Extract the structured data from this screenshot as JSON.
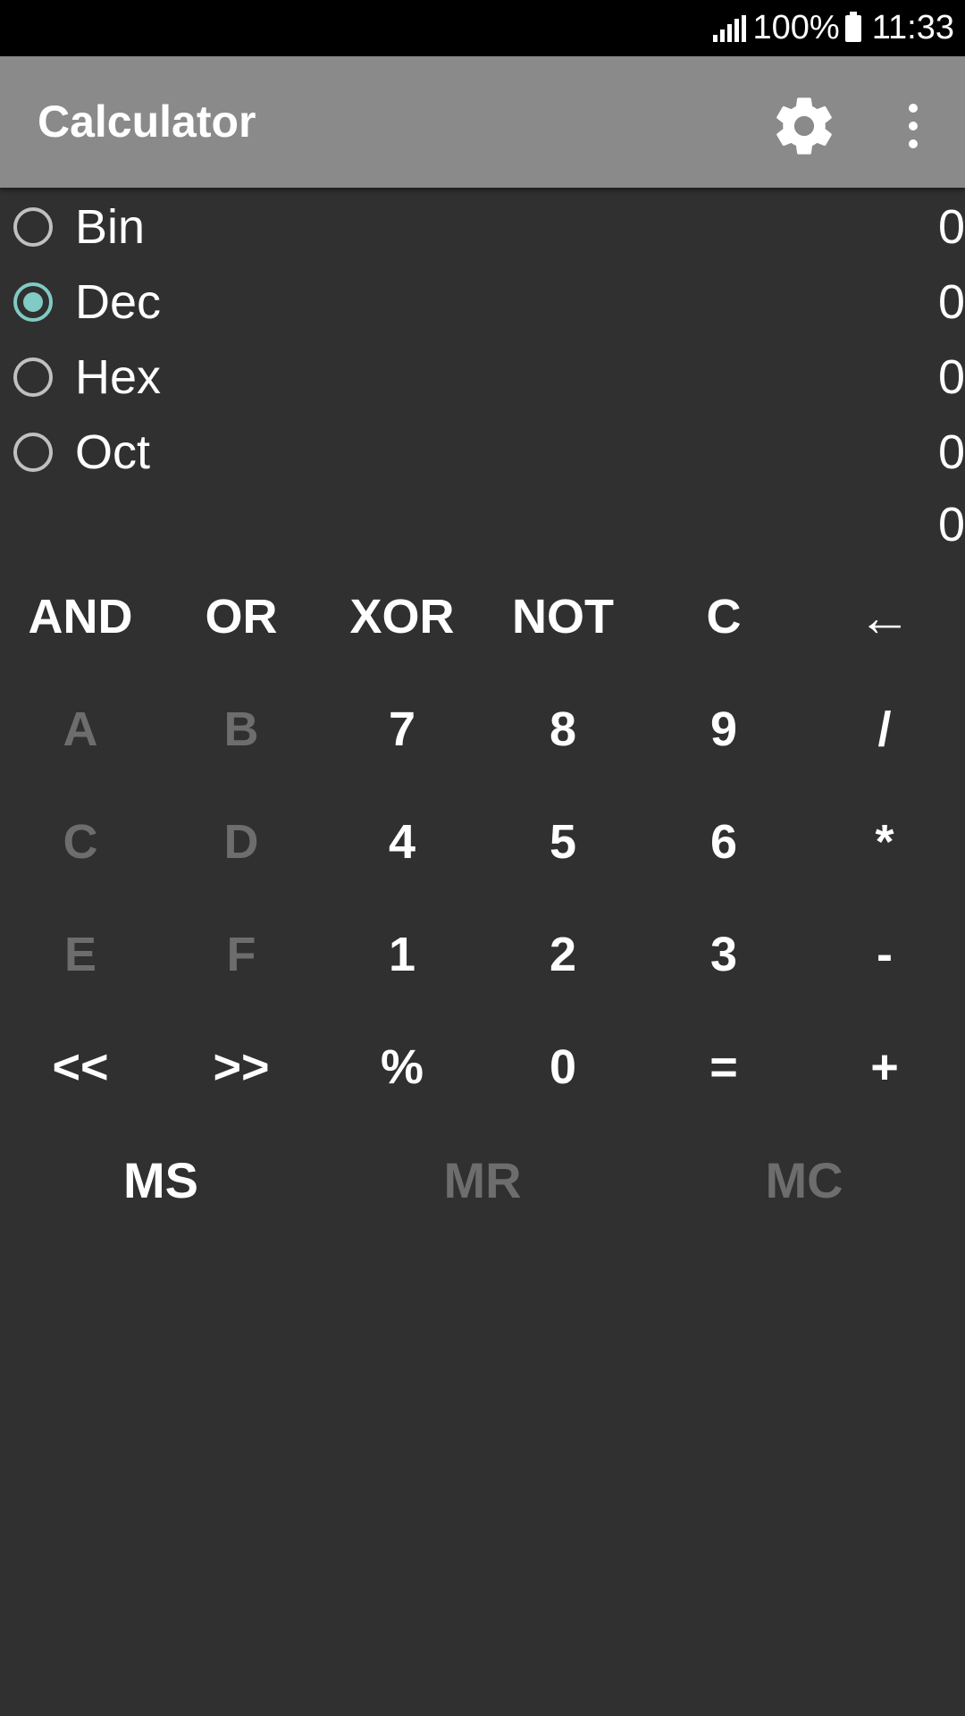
{
  "status_bar": {
    "battery": "100%",
    "time": "11:33"
  },
  "app_bar": {
    "title": "Calculator",
    "settings_icon": "gear-icon",
    "overflow_icon": "more-vert-icon"
  },
  "radix": [
    {
      "label": "Bin",
      "value": "0",
      "checked": false
    },
    {
      "label": "Dec",
      "value": "0",
      "checked": true
    },
    {
      "label": "Hex",
      "value": "0",
      "checked": false
    },
    {
      "label": "Oct",
      "value": "0",
      "checked": false
    }
  ],
  "extra_display": "0",
  "keys": {
    "row1": [
      "AND",
      "OR",
      "XOR",
      "NOT",
      "C",
      "←"
    ],
    "row2": [
      "A",
      "B",
      "7",
      "8",
      "9",
      "/"
    ],
    "row3": [
      "C",
      "D",
      "4",
      "5",
      "6",
      "*"
    ],
    "row4": [
      "E",
      "F",
      "1",
      "2",
      "3",
      "-"
    ],
    "row5": [
      "<<",
      ">>",
      "%",
      "0",
      "=",
      "+"
    ],
    "memory": [
      "MS",
      "MR",
      "MC"
    ]
  },
  "colors": {
    "background": "#303030",
    "app_bar": "#8a8a8a",
    "accent": "#80cbc4",
    "disabled_key": "#6d6d6d"
  }
}
